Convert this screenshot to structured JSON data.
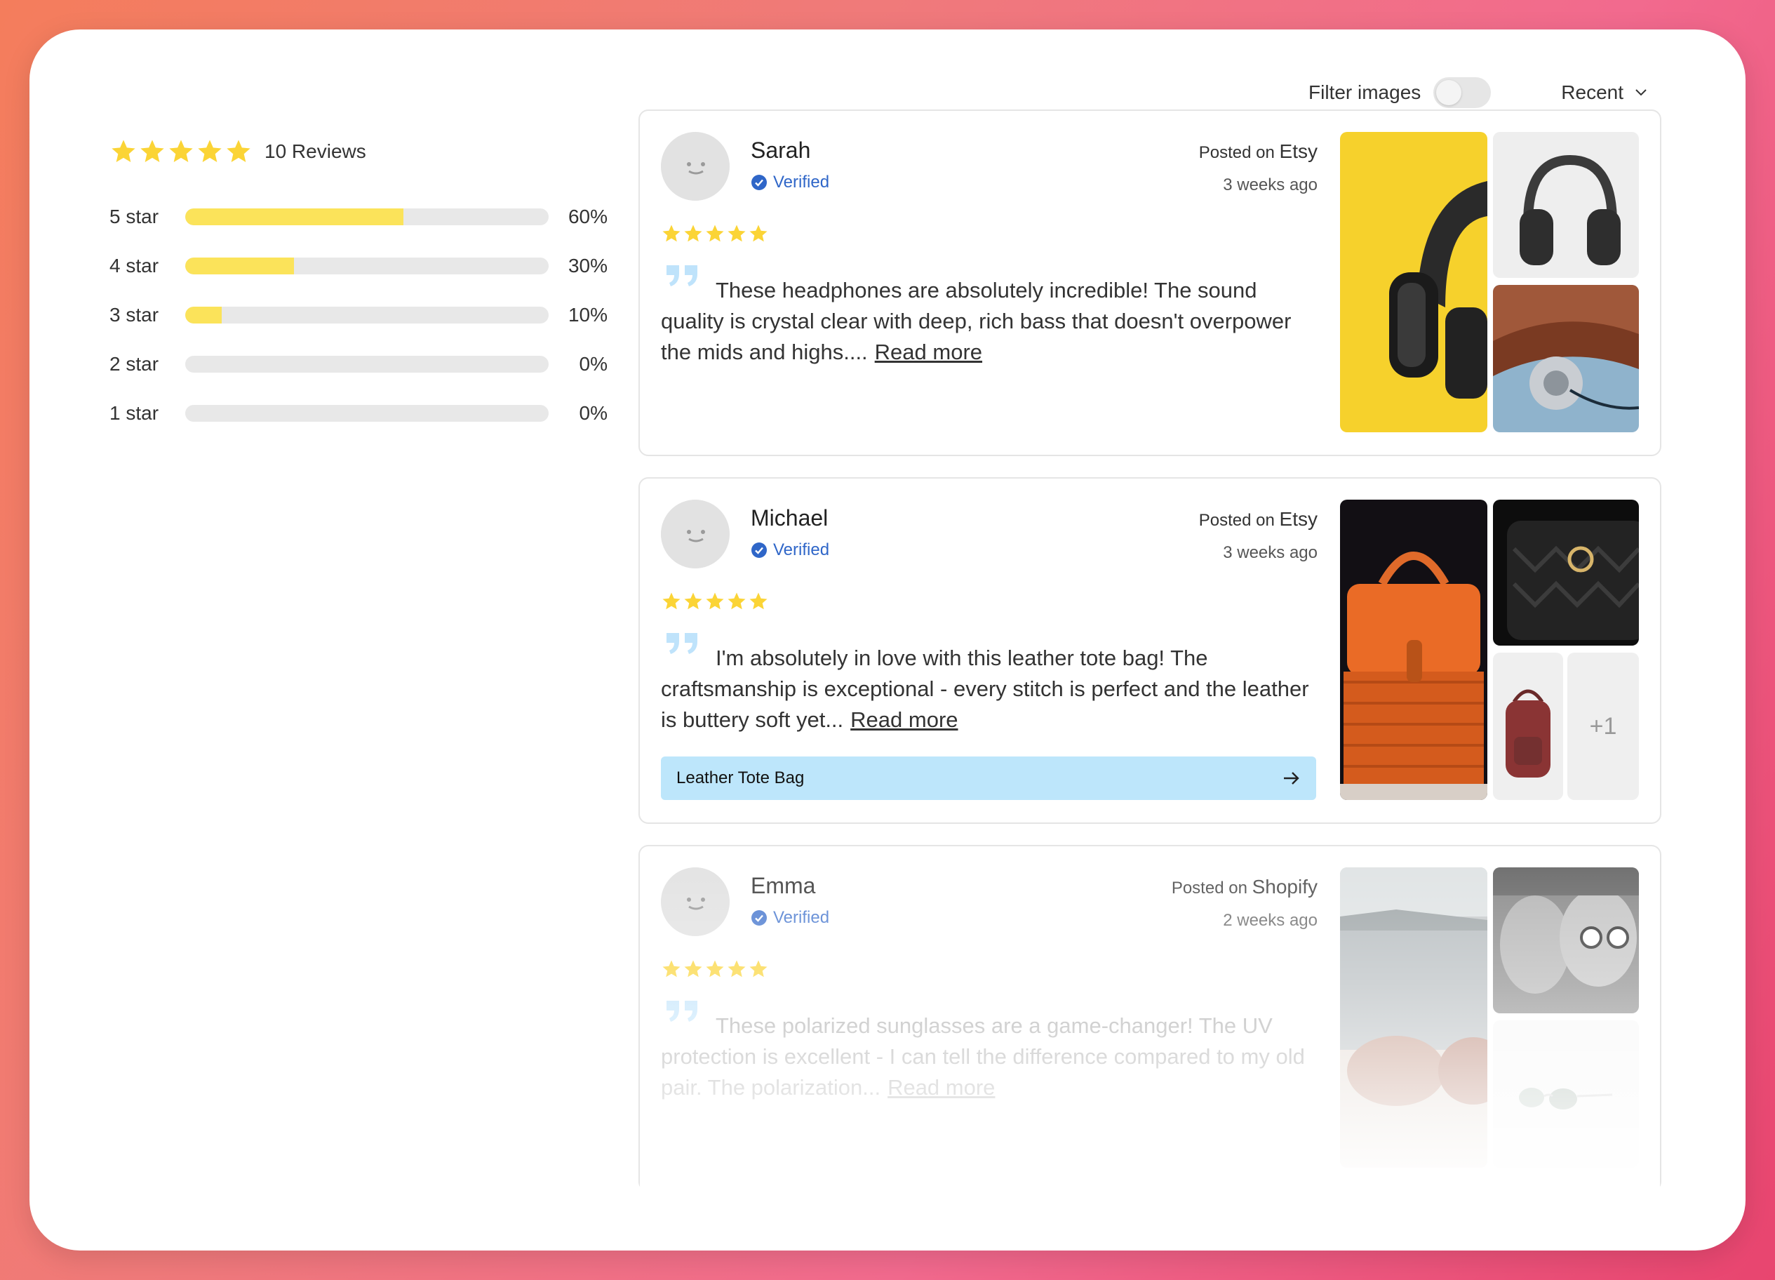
{
  "controls": {
    "filter_label": "Filter images",
    "filter_enabled": false,
    "sort_label": "Recent"
  },
  "summary": {
    "average_stars": 5,
    "reviews_label": "10 Reviews",
    "breakdown": [
      {
        "label": "5 star",
        "pct_label": "60%",
        "fraction": 0.6
      },
      {
        "label": "4 star",
        "pct_label": "30%",
        "fraction": 0.3
      },
      {
        "label": "3 star",
        "pct_label": "10%",
        "fraction": 0.1
      },
      {
        "label": "2 star",
        "pct_label": "0%",
        "fraction": 0
      },
      {
        "label": "1 star",
        "pct_label": "0%",
        "fraction": 0
      }
    ]
  },
  "reviews": [
    {
      "name": "Sarah",
      "verified": "Verified",
      "posted_prefix": "Posted on",
      "source": "Etsy",
      "ago": "3 weeks ago",
      "stars": 5,
      "text": "These headphones are absolutely incredible! The sound quality is crystal clear with deep, rich bass that doesn't overpower the mids and highs....",
      "read_more": "Read more"
    },
    {
      "name": "Michael",
      "verified": "Verified",
      "posted_prefix": "Posted on",
      "source": "Etsy",
      "ago": "3 weeks ago",
      "stars": 5,
      "text": "I'm absolutely in love with this leather tote bag! The craftsmanship is exceptional - every stitch is perfect and the leather is buttery soft yet...",
      "read_more": "Read more",
      "product": "Leather Tote Bag",
      "more_images": "+1"
    },
    {
      "name": "Emma",
      "verified": "Verified",
      "posted_prefix": "Posted on",
      "source": "Shopify",
      "ago": "2 weeks ago",
      "stars": 5,
      "text": "These polarized sunglasses are a game-changer! The UV protection is excellent - I can tell the difference compared to my old pair. The polarization...",
      "read_more": "Read more"
    }
  ],
  "colors": {
    "star": "#fbd436",
    "bar_fill": "#fbe35a",
    "verified": "#2f66c8",
    "product_bg": "#bde6fb",
    "quote": "#bfe3fb"
  },
  "icons": {
    "star": "star-icon",
    "verified": "verified-badge-icon",
    "quote": "quote-icon",
    "arrow": "arrow-right-icon",
    "chevron": "chevron-down-icon"
  }
}
